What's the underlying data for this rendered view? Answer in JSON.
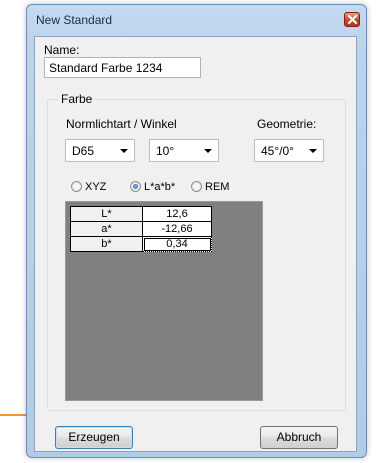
{
  "window": {
    "title": "New Standard"
  },
  "name": {
    "label": "Name:",
    "value": "Standard Farbe 1234"
  },
  "farbe": {
    "legend": "Farbe",
    "illuminant_label": "Normlichtart / Winkel",
    "illuminant_value": "D65",
    "angle_value": "10°",
    "geometry_label": "Geometrie:",
    "geometry_value": "45°/0°"
  },
  "color_space": {
    "options": [
      "XYZ",
      "L*a*b*",
      "REM"
    ],
    "selected": "L*a*b*"
  },
  "lab_table": {
    "rows": [
      {
        "label": "L*",
        "value": "12,6"
      },
      {
        "label": "a*",
        "value": "-12,66"
      },
      {
        "label": "b*",
        "value": "0,34"
      }
    ]
  },
  "buttons": {
    "create": "Erzeugen",
    "cancel": "Abbruch"
  },
  "colors": {
    "titlebar": "#c4daf2",
    "close": "#c7462d",
    "callout": "#f0972e",
    "grid_bg": "#808080"
  }
}
